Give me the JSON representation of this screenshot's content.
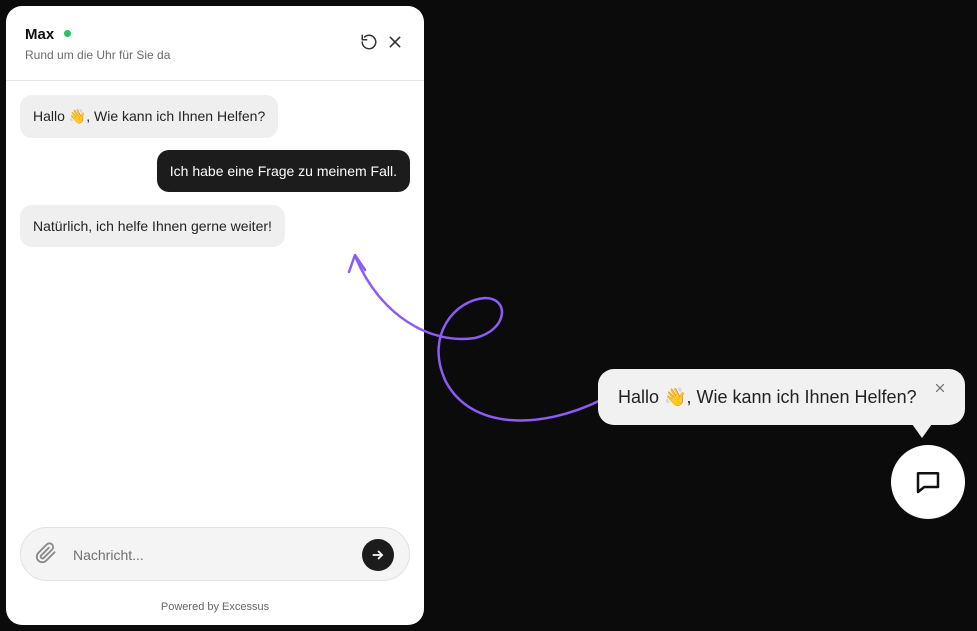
{
  "chat": {
    "agent_name": "Max",
    "agent_status_color": "#22c55e",
    "subtitle": "Rund um die Uhr für Sie da",
    "header_icons": [
      "refresh-icon",
      "close-icon"
    ],
    "messages": [
      {
        "sender": "bot",
        "text_before": "Hallo ",
        "emoji": "👋",
        "text_after": ", Wie kann ich Ihnen Helfen?"
      },
      {
        "sender": "user",
        "text": "Ich habe eine Frage zu meinem Fall."
      },
      {
        "sender": "bot",
        "text": "Natürlich, ich helfe Ihnen gerne weiter!"
      }
    ],
    "composer": {
      "placeholder": "Nachricht...",
      "value": "",
      "attach_icon": "paperclip-icon",
      "send_icon": "arrow-right-icon"
    },
    "powered_by": "Powered by Excessus"
  },
  "preview": {
    "text_before": "Hallo ",
    "emoji": "👋",
    "text_after": ", Wie kann ich Ihnen Helfen?",
    "close_icon": "close-icon"
  },
  "launcher": {
    "icon": "chat-bubble-icon"
  },
  "colors": {
    "background": "#0b0b0b",
    "user_bubble": "#1c1c1c",
    "bot_bubble": "#efefef",
    "annotation_arrow": "#8b5cf6"
  }
}
